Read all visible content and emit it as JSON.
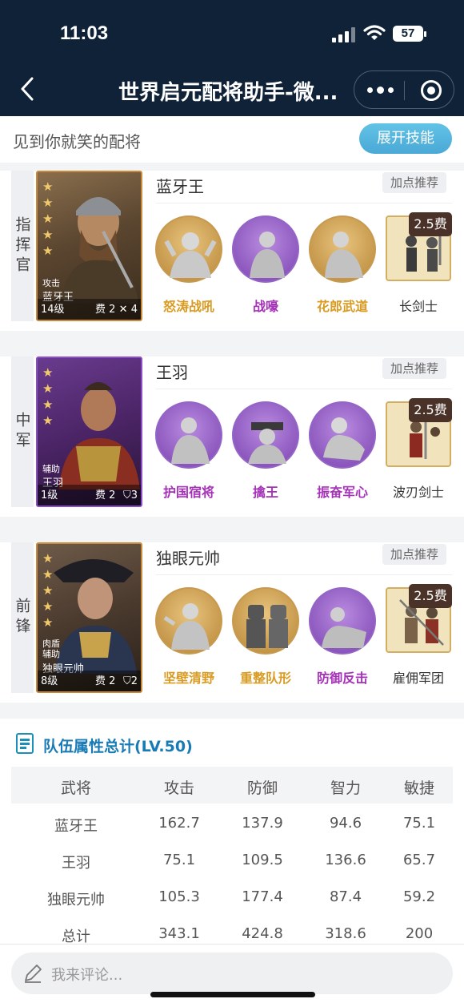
{
  "status": {
    "time": "11:03",
    "battery": "57"
  },
  "nav": {
    "title": "世界启元配将助手-微..."
  },
  "header": {
    "heading": "见到你就笑的配将",
    "skill_button": "展开技能"
  },
  "heroes": [
    {
      "role": "指挥官",
      "name": "蓝牙王",
      "add_points": "加点推荐",
      "portrait": {
        "troop": "攻击",
        "name": "蓝牙王",
        "level": "14级",
        "cost": "费 2",
        "count": "4",
        "stars": 5
      },
      "skills": [
        {
          "label": "怒涛战吼",
          "tier": "gold"
        },
        {
          "label": "战嚎",
          "tier": "violet"
        },
        {
          "label": "花郎武道",
          "tier": "gold"
        }
      ],
      "unit": {
        "cost": "2.5费",
        "label": "长剑士"
      }
    },
    {
      "role": "中军",
      "name": "王羽",
      "add_points": "加点推荐",
      "portrait": {
        "troop": "辅助",
        "name": "王羽",
        "level": "1级",
        "cost": "费 2",
        "count": "3",
        "stars": 4
      },
      "skills": [
        {
          "label": "护国宿将",
          "tier": "violet"
        },
        {
          "label": "擒王",
          "tier": "violet"
        },
        {
          "label": "振奋军心",
          "tier": "violet"
        }
      ],
      "unit": {
        "cost": "2.5费",
        "label": "波刃剑士"
      }
    },
    {
      "role": "前锋",
      "name": "独眼元帅",
      "add_points": "加点推荐",
      "portrait": {
        "troop": "肉盾\n辅助",
        "name": "独眼元帅",
        "level": "8级",
        "cost": "费 2",
        "count": "2",
        "stars": 5
      },
      "skills": [
        {
          "label": "坚壁清野",
          "tier": "gold"
        },
        {
          "label": "重整队形",
          "tier": "gold"
        },
        {
          "label": "防御反击",
          "tier": "violet"
        }
      ],
      "unit": {
        "cost": "2.5费",
        "label": "雇佣军团"
      }
    }
  ],
  "stats": {
    "title": "队伍属性总计(LV.50)",
    "headers": [
      "武将",
      "攻击",
      "防御",
      "智力",
      "敏捷"
    ],
    "rows": [
      [
        "蓝牙王",
        "162.7",
        "137.9",
        "94.6",
        "75.1"
      ],
      [
        "王羽",
        "75.1",
        "109.5",
        "136.6",
        "65.7"
      ],
      [
        "独眼元帅",
        "105.3",
        "177.4",
        "87.4",
        "59.2"
      ],
      [
        "总计",
        "343.1",
        "424.8",
        "318.6",
        "200"
      ]
    ]
  },
  "comment": {
    "placeholder": "我来评论..."
  },
  "colors": {
    "nav_bg": "#0f2237",
    "accent_blue": "#4aa9d6",
    "gold_skill": "#d99b22",
    "violet_skill": "#a631b9"
  },
  "icons": [
    "back-arrow-icon",
    "more-dots-icon",
    "target-icon",
    "list-icon",
    "pen-icon",
    "star-icon"
  ]
}
